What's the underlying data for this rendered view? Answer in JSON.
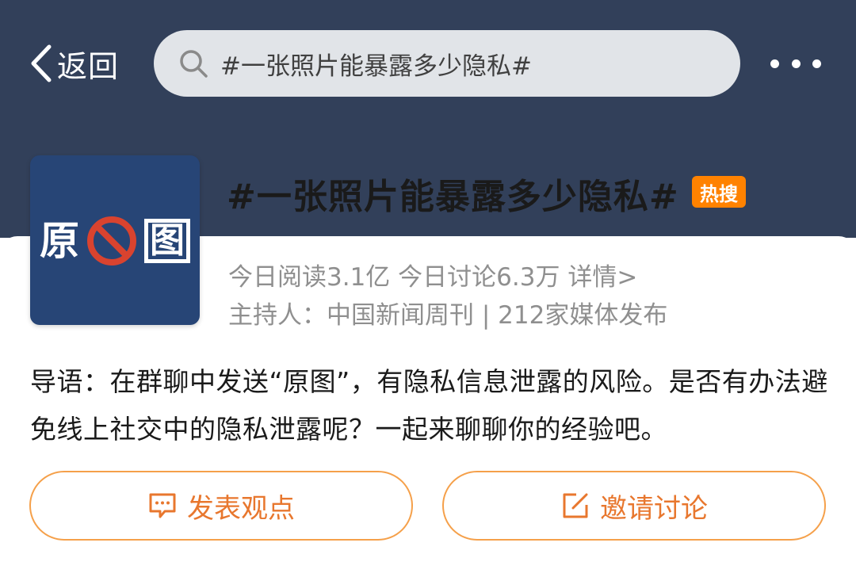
{
  "header": {
    "back_label": "返回",
    "search_text": "#一张照片能暴露多少隐私#"
  },
  "topic": {
    "cover_left_char": "原",
    "cover_right_char": "图",
    "title": "#一张照片能暴露多少隐私#",
    "badge": "热搜",
    "reads": "今日阅读3.1亿",
    "discussions": "今日讨论6.3万",
    "details_link": "详情>",
    "host_label": "主持人：",
    "host_name": "中国新闻周刊",
    "separator": "|",
    "media_count": "212家媒体发布",
    "intro": "导语：在群聊中发送“原图”，有隐私信息泄露的风险。是否有办法避免线上社交中的隐私泄露呢？一起来聊聊你的经验吧。"
  },
  "actions": {
    "post_label": "发表观点",
    "invite_label": "邀请讨论"
  },
  "colors": {
    "header_bg": "#32405a",
    "accent_orange": "#ff8200",
    "button_text": "#e8772e",
    "cover_bg": "#274576",
    "ban_red": "#d9432f"
  }
}
